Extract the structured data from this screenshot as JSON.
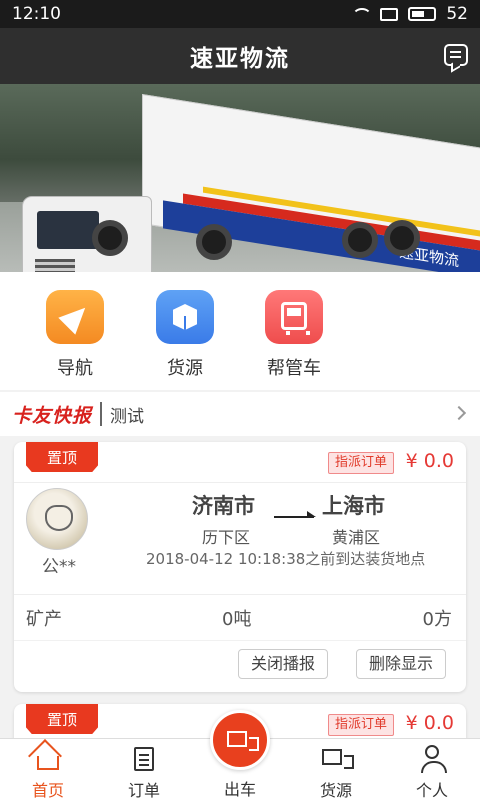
{
  "status_bar": {
    "time": "12:10",
    "battery": "52"
  },
  "title_bar": {
    "title": "速亚物流",
    "message_icon": "message-icon"
  },
  "banner": {
    "trailer_text": "速亚物流"
  },
  "quick_nav": [
    {
      "label": "导航",
      "icon": "navigation-icon",
      "color": "#f48a22"
    },
    {
      "label": "货源",
      "icon": "package-icon",
      "color": "#3a7be8"
    },
    {
      "label": "帮管车",
      "icon": "truck-manage-icon",
      "color": "#ef4d4d"
    }
  ],
  "news": {
    "brand": "卡友快报",
    "text": "测试"
  },
  "orders": [
    {
      "pin_label": "置顶",
      "type_label": "指派订单",
      "price": "¥ 0.0",
      "user_name": "公**",
      "from_city": "济南市",
      "from_district": "历下区",
      "to_city": "上海市",
      "to_district": "黄浦区",
      "deadline": "2018-04-12 10:18:38之前到达装货地点",
      "cargo_type": "矿产",
      "weight": "0吨",
      "volume": "0方",
      "actions": {
        "close": "关闭播报",
        "delete": "删除显示"
      }
    },
    {
      "pin_label": "置顶",
      "type_label": "指派订单",
      "price": "¥ 0.0"
    }
  ],
  "bottom_nav": {
    "home": "首页",
    "orders": "订单",
    "depart": "出车",
    "goods": "货源",
    "profile": "个人"
  },
  "colors": {
    "accent": "#e8541e",
    "price": "#e53935",
    "title_bar": "#2f2f2f"
  }
}
